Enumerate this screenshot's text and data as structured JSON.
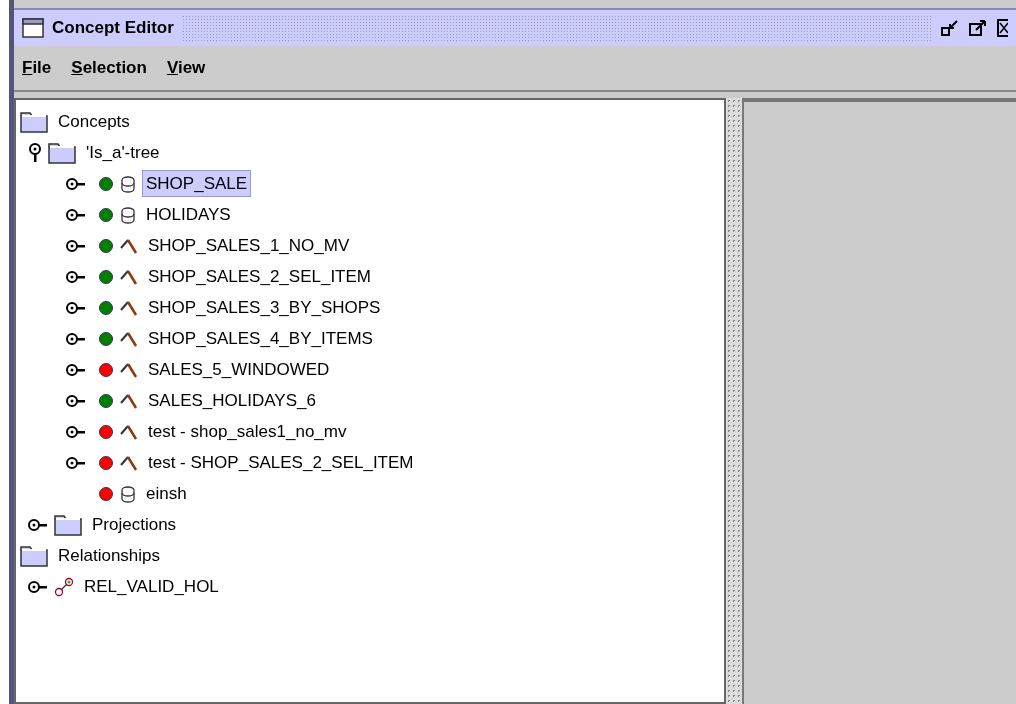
{
  "window": {
    "title": "Concept Editor"
  },
  "menu": [
    {
      "label": "File"
    },
    {
      "label": "Selection"
    },
    {
      "label": "View"
    }
  ],
  "tree": [
    {
      "label": "Concepts",
      "kind": "folder",
      "selected": false,
      "children": [
        {
          "label": "'Is_a'-tree",
          "kind": "folder",
          "expanded": true,
          "selected": false,
          "children": [
            {
              "label": "SHOP_SALE",
              "kind": "table",
              "expanded": false,
              "color": "#008000",
              "selected": true
            },
            {
              "label": "HOLIDAYS",
              "kind": "table",
              "expanded": false,
              "color": "#008000",
              "selected": false
            },
            {
              "label": "SHOP_SALES_1_NO_MV",
              "kind": "query",
              "expanded": false,
              "color": "#008000",
              "selected": false
            },
            {
              "label": "SHOP_SALES_2_SEL_ITEM",
              "kind": "query",
              "expanded": false,
              "color": "#008000",
              "selected": false
            },
            {
              "label": "SHOP_SALES_3_BY_SHOPS",
              "kind": "query",
              "expanded": false,
              "color": "#008000",
              "selected": false
            },
            {
              "label": "SHOP_SALES_4_BY_ITEMS",
              "kind": "query",
              "expanded": false,
              "color": "#008000",
              "selected": false
            },
            {
              "label": "SALES_5_WINDOWED",
              "kind": "query",
              "expanded": false,
              "color": "#ff0000",
              "selected": false
            },
            {
              "label": "SALES_HOLIDAYS_6",
              "kind": "query",
              "expanded": false,
              "color": "#008000",
              "selected": false
            },
            {
              "label": "test - shop_sales1_no_mv",
              "kind": "query",
              "expanded": false,
              "color": "#ff0000",
              "selected": false
            },
            {
              "label": "test - SHOP_SALES_2_SEL_ITEM",
              "kind": "query",
              "expanded": false,
              "color": "#ff0000",
              "selected": false
            },
            {
              "label": "einsh",
              "kind": "table",
              "color": "#ff0000",
              "selected": false
            }
          ]
        },
        {
          "label": "Projections",
          "kind": "folder",
          "expanded": false,
          "selected": false
        }
      ]
    },
    {
      "label": "Relationships",
      "kind": "folder",
      "selected": false,
      "children": [
        {
          "label": "REL_VALID_HOL",
          "kind": "relationship",
          "expanded": false,
          "selected": false
        }
      ]
    }
  ]
}
